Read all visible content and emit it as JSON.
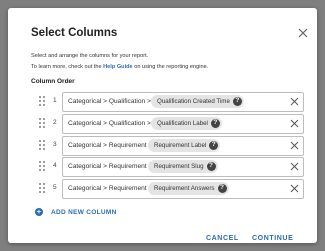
{
  "dialog": {
    "title": "Select Columns",
    "description_line1": "Select and arrange the columns for your report.",
    "description_line2_pre": "To learn more, check out the ",
    "description_link": "Help Guide",
    "description_line2_post": " on using the reporting engine.",
    "section_label": "Column Order"
  },
  "rows": [
    {
      "number": "1",
      "path": "Categorical > Qualification >",
      "chip": "Qualification Created Time",
      "help": "?"
    },
    {
      "number": "2",
      "path": "Categorical > Qualification >",
      "chip": "Qualification Label",
      "help": "?"
    },
    {
      "number": "3",
      "path": "Categorical > Requirement >",
      "chip": "Requirement Label",
      "help": "?"
    },
    {
      "number": "4",
      "path": "Categorical > Requirement >",
      "chip": "Requirement Slug",
      "help": "?"
    },
    {
      "number": "5",
      "path": "Categorical > Requirement >",
      "chip": "Requirement Answers",
      "help": "?"
    }
  ],
  "add_column": {
    "icon": "plus-icon",
    "label": "ADD NEW COLUMN"
  },
  "footer": {
    "cancel_label": "CANCEL",
    "continue_label": "CONTINUE"
  },
  "colors": {
    "accent": "#2a6db5",
    "overlay": "#7f7f7f",
    "chip_bg": "#e4e4e4"
  }
}
